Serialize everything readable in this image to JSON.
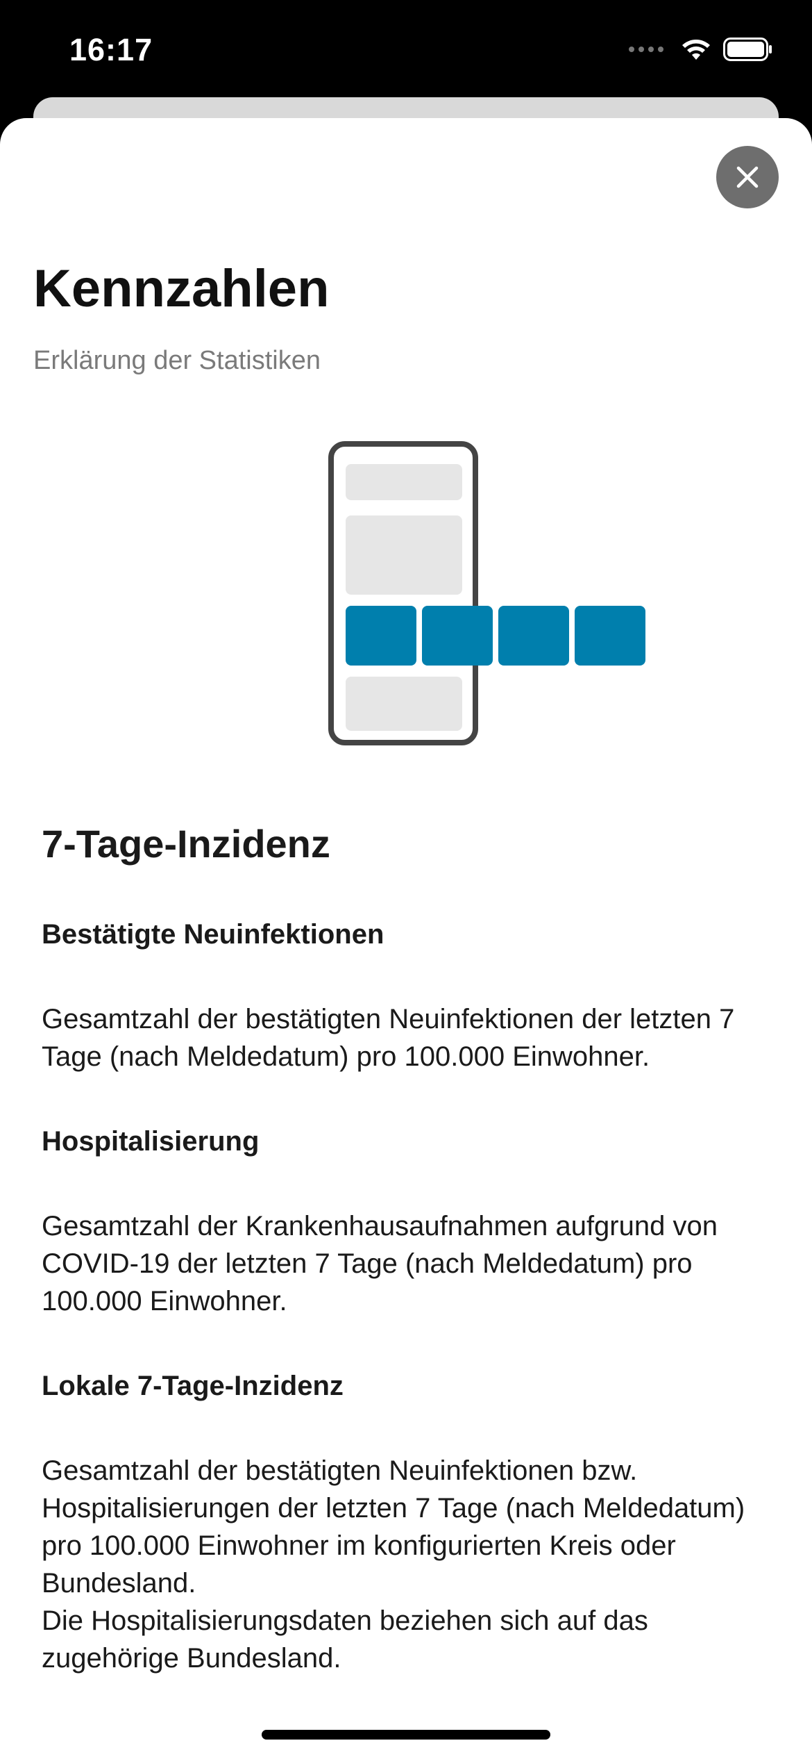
{
  "status_bar": {
    "time": "16:17",
    "icons": [
      "signal-dots-icon",
      "wifi-icon",
      "battery-icon"
    ]
  },
  "sheet": {
    "close_icon": "close-icon",
    "title": "Kennzahlen",
    "subtitle": "Erklärung der Statistiken",
    "illustration_icon": "phone-statistics-illustration"
  },
  "content": {
    "section_title": "7-Tage-Inzidenz",
    "items": [
      {
        "heading": "Bestätigte Neuinfektionen",
        "text": "Gesamtzahl der bestätigten Neuinfektionen der letzten 7 Tage (nach Meldedatum) pro 100.000 Einwohner."
      },
      {
        "heading": "Hospitalisierung",
        "text": "Gesamtzahl der Krankenhausaufnahmen aufgrund von COVID-19 der letzten 7 Tage (nach Meldedatum) pro 100.000 Einwohner."
      },
      {
        "heading": "Lokale 7-Tage-Inzidenz",
        "text": "Gesamtzahl der bestätigten Neuinfektionen bzw. Hospitalisierungen der letzten 7 Tage (nach Meldedatum) pro 100.000 Einwohner im konfigurierten Kreis oder Bundesland.",
        "text2": "Die Hospitalisierungsdaten beziehen sich auf das zugehörige Bundesland."
      }
    ]
  },
  "colors": {
    "accent": "#007fad",
    "placeholder": "#e6e6e6",
    "close_bg": "#6e6e6e"
  }
}
